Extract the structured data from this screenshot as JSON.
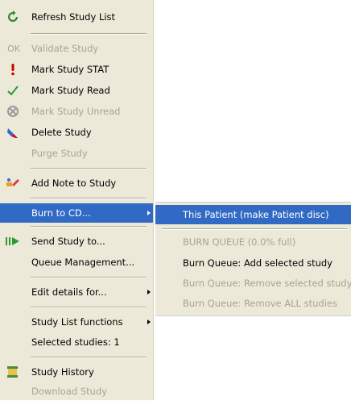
{
  "menu": {
    "refresh": "Refresh Study List",
    "validate_prefix": "OK",
    "validate": "Validate Study",
    "mark_stat": "Mark Study STAT",
    "mark_read": "Mark Study Read",
    "mark_unread": "Mark Study Unread",
    "delete": "Delete Study",
    "purge": "Purge Study",
    "add_note": "Add Note to Study",
    "burn": "Burn to CD...",
    "send": "Send Study to...",
    "queue": "Queue Management...",
    "edit": "Edit details for...",
    "list_functions": "Study List functions",
    "selected": "Selected studies: 1",
    "history": "Study History",
    "download": "Download Study"
  },
  "burn_submenu": {
    "this_patient": "This Patient (make Patient disc)",
    "burn_queue": "BURN QUEUE (0.0% full)",
    "add_selected": "Burn Queue: Add selected study",
    "remove_selected": "Burn Queue: Remove selected study",
    "remove_all": "Burn Queue: Remove ALL studies"
  },
  "colors": {
    "menu_bg": "#ece9d8",
    "highlight": "#316ac5",
    "disabled_text": "#a8a494",
    "stat_red": "#cc0000",
    "check_green": "#2e9a2e"
  }
}
